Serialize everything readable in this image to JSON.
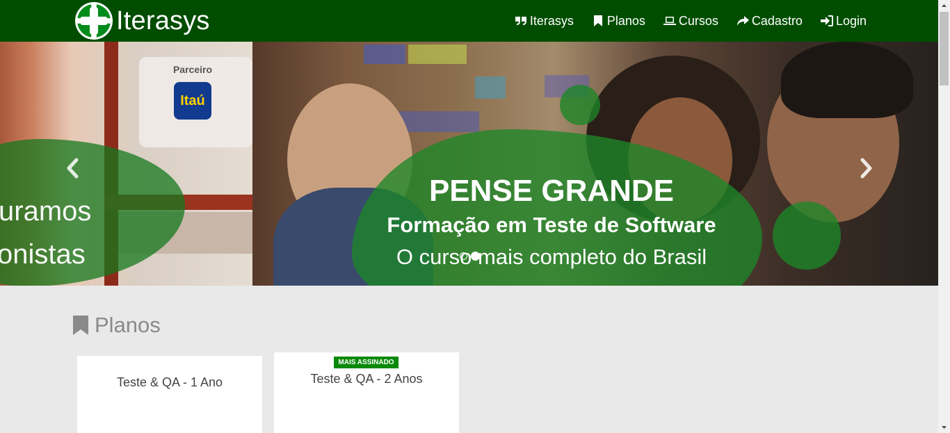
{
  "brand": {
    "name": "Iterasys"
  },
  "nav": {
    "items": [
      {
        "label": "Iterasys",
        "icon": "quote-icon"
      },
      {
        "label": "Planos",
        "icon": "bookmark-icon"
      },
      {
        "label": "Cursos",
        "icon": "laptop-icon"
      },
      {
        "label": "Cadastro",
        "icon": "share-icon"
      },
      {
        "label": "Login",
        "icon": "sign-in-icon"
      }
    ]
  },
  "carousel": {
    "prev_slide": {
      "partner_label": "Parceiro",
      "partner_logo": "Itaú",
      "text_line1": "uramos",
      "text_line2": "onistas"
    },
    "active_slide": {
      "title": "PENSE GRANDE",
      "subtitle": "Formação em Teste de Software",
      "tagline": "O curso mais completo do Brasil"
    },
    "indicators": {
      "count": 2,
      "active_index": 1
    }
  },
  "planos": {
    "title": "Planos",
    "cards": [
      {
        "name": "Teste & QA - 1 Ano",
        "badge": ""
      },
      {
        "name": "Teste & QA - 2 Anos",
        "badge": "MAIS ASSINADO"
      }
    ]
  },
  "colors": {
    "navbar": "#004d00",
    "accent_green": "#1c8728",
    "badge_green": "#0a8a0a",
    "page_bg": "#e9e9e9"
  }
}
